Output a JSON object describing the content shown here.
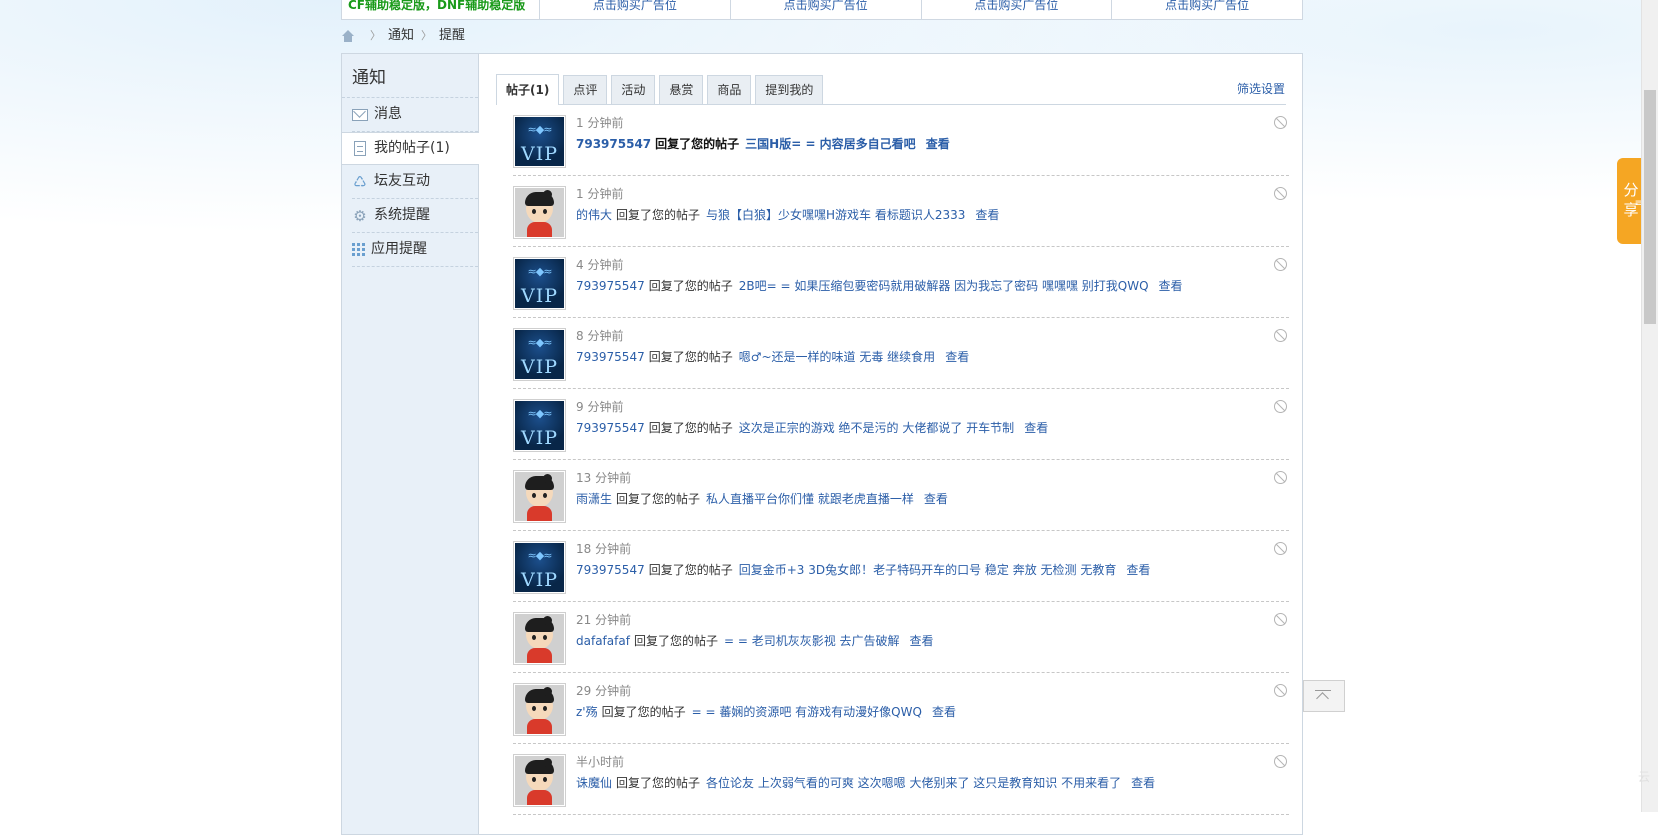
{
  "adbar": {
    "first": "CF辅助稳定版，DNF辅助稳定版",
    "cells": [
      "点击购买广告位",
      "点击购买广告位",
      "点击购买广告位",
      "点击购买广告位"
    ]
  },
  "breadcrumb": {
    "items": [
      "通知",
      "提醒"
    ]
  },
  "sidebar": {
    "title": "通知",
    "items": [
      {
        "label": "消息",
        "icon": "mail-icon"
      },
      {
        "label": "我的帖子(1)",
        "icon": "document-icon"
      },
      {
        "label": "坛友互动",
        "icon": "recycle-icon"
      },
      {
        "label": "系统提醒",
        "icon": "gear-icon"
      },
      {
        "label": "应用提醒",
        "icon": "grid-icon"
      }
    ]
  },
  "tabs": {
    "items": [
      "帖子(1)",
      "点评",
      "活动",
      "悬赏",
      "商品",
      "提到我的"
    ],
    "active": 0,
    "filter_label": "筛选设置"
  },
  "notifications": [
    {
      "time": "1 分钟前",
      "user": "793975547",
      "action": "回复了您的帖子",
      "thread": "三国H版= = 内容居多自己看吧",
      "view": "查看",
      "avatar": "vip-avatar",
      "unread": true
    },
    {
      "time": "1 分钟前",
      "user": "的伟大",
      "action": "回复了您的帖子",
      "thread": "与狼【白狼】少女嘿嘿H游戏车 看标题识人2333",
      "view": "查看",
      "avatar": "default-avatar",
      "unread": false
    },
    {
      "time": "4 分钟前",
      "user": "793975547",
      "action": "回复了您的帖子",
      "thread": "2B吧= = 如果压缩包要密码就用破解器 因为我忘了密码 嘿嘿嘿 别打我QWQ",
      "view": "查看",
      "avatar": "vip-avatar",
      "unread": false
    },
    {
      "time": "8 分钟前",
      "user": "793975547",
      "action": "回复了您的帖子",
      "thread": "嗯♂~还是一样的味道 无毒 继续食用",
      "view": "查看",
      "avatar": "vip-avatar",
      "unread": false
    },
    {
      "time": "9 分钟前",
      "user": "793975547",
      "action": "回复了您的帖子",
      "thread": "这次是正宗的游戏 绝不是污的 大佬都说了 开车节制",
      "view": "查看",
      "avatar": "vip-avatar",
      "unread": false
    },
    {
      "time": "13 分钟前",
      "user": "雨潇生",
      "action": "回复了您的帖子",
      "thread": "私人直播平台你们懂 就跟老虎直播一样",
      "view": "查看",
      "avatar": "default-avatar",
      "unread": false
    },
    {
      "time": "18 分钟前",
      "user": "793975547",
      "action": "回复了您的帖子",
      "thread": "回复金币+3 3D兔女郎！老子特码开车的口号 稳定 奔放 无检测 无教育",
      "view": "查看",
      "avatar": "vip-avatar",
      "unread": false
    },
    {
      "time": "21 分钟前",
      "user": "dafafafaf",
      "action": "回复了您的帖子",
      "thread": "= = 老司机灰灰影视 去广告破解",
      "view": "查看",
      "avatar": "default-avatar",
      "unread": false
    },
    {
      "time": "29 分钟前",
      "user": "z'殇",
      "action": "回复了您的帖子",
      "thread": "= = 蕃娴的资源吧 有游戏有动漫好像QWQ",
      "view": "查看",
      "avatar": "default-avatar",
      "unread": false
    },
    {
      "time": "半小时前",
      "user": "诛魔仙",
      "action": "回复了您的帖子",
      "thread": "各位论友 上次弱气看的可爽 这次嗯嗯 大佬别来了 这只是教育知识 不用来看了",
      "view": "查看",
      "avatar": "default-avatar",
      "unread": false
    }
  ],
  "share": {
    "label": "分享",
    "icon": "share-menu-icon"
  },
  "widgets": {
    "totop": "back-to-top-icon",
    "edge_text": "云"
  },
  "colors": {
    "link": "#2b5ea8",
    "sidebar_bg": "#e8f0f8",
    "share": "#f5a623",
    "ad_green": "#1a9a1a"
  }
}
